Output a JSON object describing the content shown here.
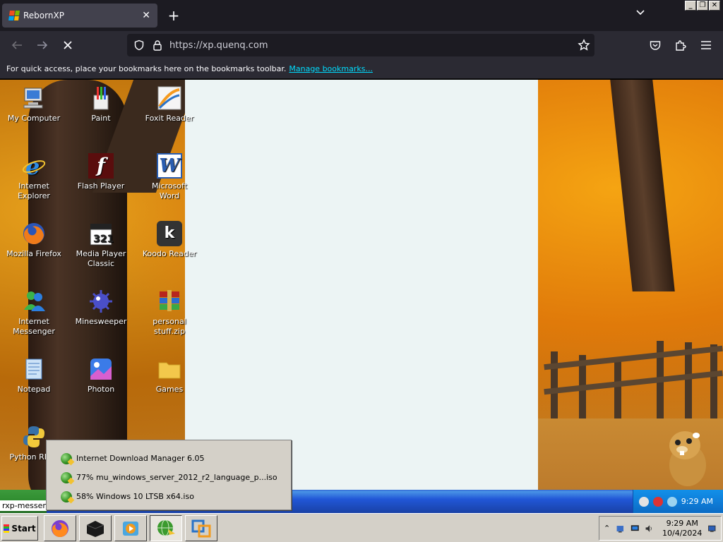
{
  "browser": {
    "tab_title": "RebornXP",
    "url": "https://xp.quenq.com",
    "bookmarks_hint": "For quick access, place your bookmarks here on the bookmarks toolbar.",
    "bookmarks_link": "Manage bookmarks..."
  },
  "desktop": {
    "icons": [
      {
        "label": "My Computer",
        "icon": "computer-icon"
      },
      {
        "label": "Paint",
        "icon": "paint-icon"
      },
      {
        "label": "Foxit Reader",
        "icon": "foxit-icon"
      },
      {
        "label": "Internet Explorer",
        "icon": "ie-icon"
      },
      {
        "label": "Flash Player",
        "icon": "flash-icon"
      },
      {
        "label": "Microsoft Word",
        "icon": "word-icon"
      },
      {
        "label": "Mozilla Firefox",
        "icon": "firefox-icon"
      },
      {
        "label": "Media Player Classic",
        "icon": "mpc-icon"
      },
      {
        "label": "Koodo Reader",
        "icon": "koodo-icon"
      },
      {
        "label": "Internet Messenger",
        "icon": "messenger-icon"
      },
      {
        "label": "Minesweeper",
        "icon": "mine-icon"
      },
      {
        "label": "personal stuff.zip",
        "icon": "zip-icon"
      },
      {
        "label": "Notepad",
        "icon": "notepad-icon"
      },
      {
        "label": "Photon",
        "icon": "photon-icon"
      },
      {
        "label": "Games",
        "icon": "folder-icon"
      },
      {
        "label": "Python REPL",
        "icon": "python-icon"
      }
    ],
    "status_text": "rxp-messeng",
    "xp_tray_time": "9:29 AM"
  },
  "idm_menu": {
    "items": [
      {
        "label": "Internet Download Manager 6.05"
      },
      {
        "label": "77% mu_windows_server_2012_r2_language_p...iso"
      },
      {
        "label": "58% Windows 10 LTSB x64.iso"
      }
    ]
  },
  "host_taskbar": {
    "start_label": "Start",
    "time": "9:29 AM",
    "date": "10/4/2024"
  },
  "host_controls": {
    "minimize": "_",
    "restore": "❐",
    "close": "✕"
  }
}
